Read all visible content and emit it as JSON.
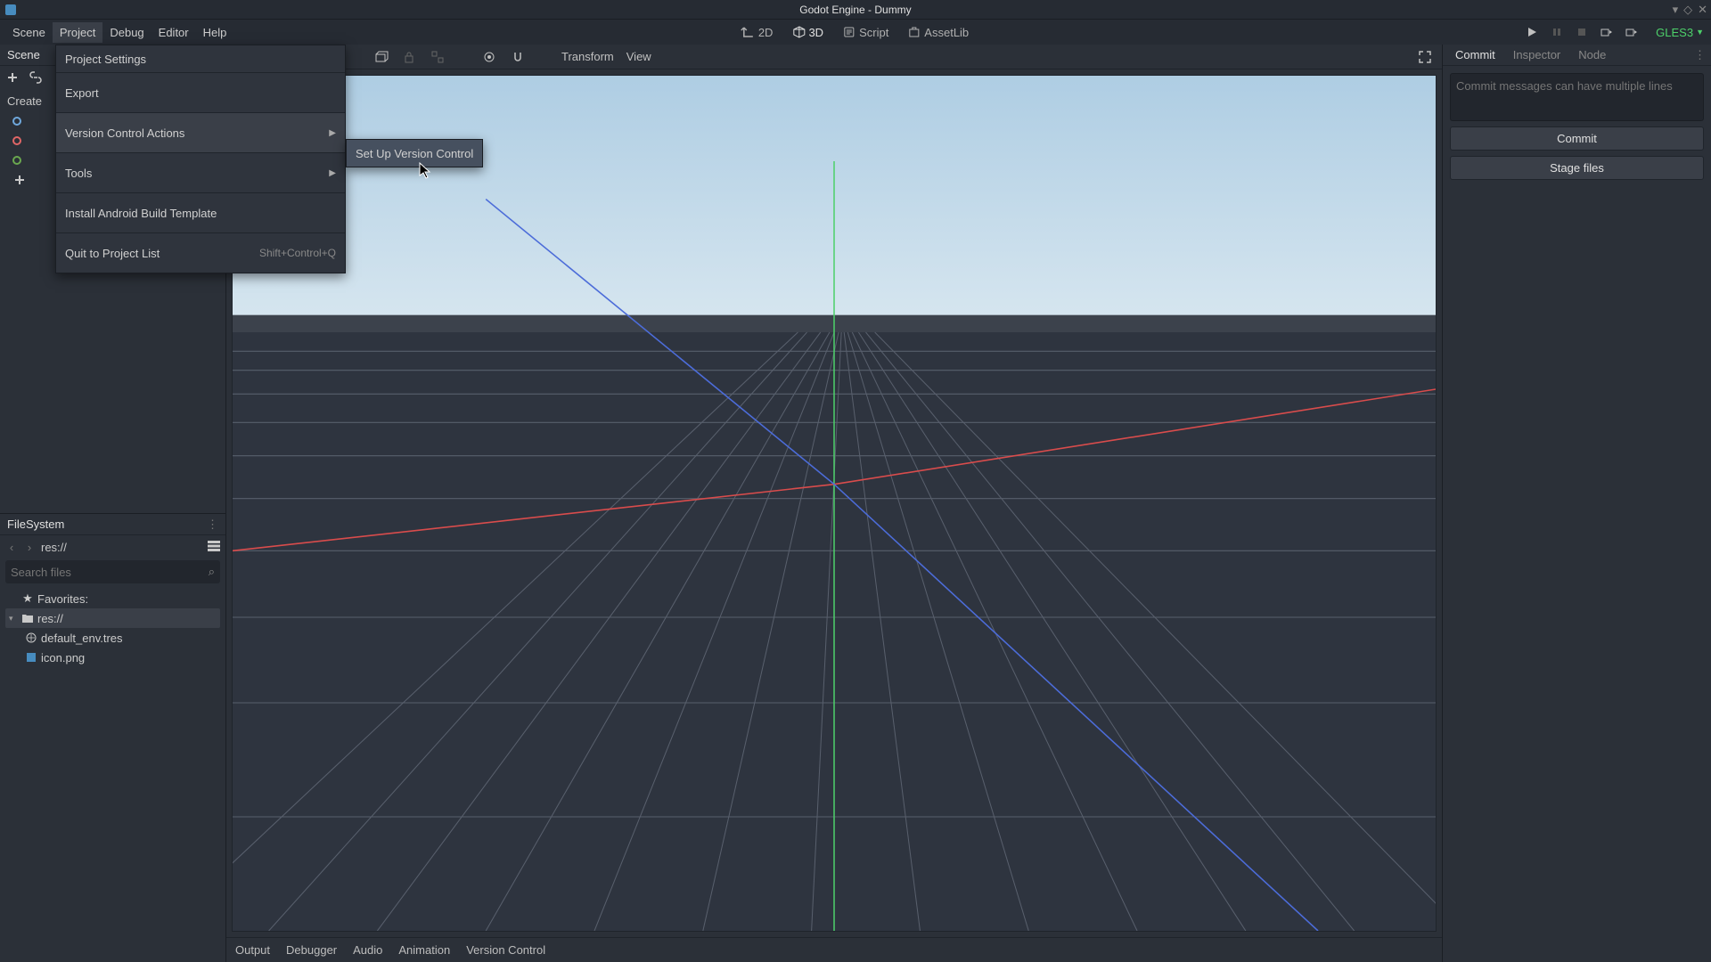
{
  "titlebar": {
    "title": "Godot Engine - Dummy"
  },
  "menubar": {
    "items": [
      "Scene",
      "Project",
      "Debug",
      "Editor",
      "Help"
    ],
    "active_index": 1,
    "modes": {
      "d2": "2D",
      "d3": "3D",
      "script": "Script",
      "assetlib": "AssetLib"
    },
    "renderer": "GLES3"
  },
  "dropdown": {
    "project_settings": "Project Settings",
    "export": "Export",
    "vcs_actions": "Version Control Actions",
    "tools": "Tools",
    "install_android": "Install Android Build Template",
    "quit": "Quit to Project List",
    "quit_shortcut": "Shift+Control+Q"
  },
  "submenu": {
    "setup_vcs": "Set Up Version Control"
  },
  "scene_dock": {
    "title": "Scene",
    "create_label": "Create"
  },
  "filesystem": {
    "title": "FileSystem",
    "path": "res://",
    "search_placeholder": "Search files",
    "favorites": "Favorites:",
    "root": "res://",
    "files": [
      "default_env.tres",
      "icon.png"
    ]
  },
  "viewport_toolbar": {
    "transform": "Transform",
    "view": "View"
  },
  "bottom_tabs": [
    "Output",
    "Debugger",
    "Audio",
    "Animation",
    "Version Control"
  ],
  "right_dock": {
    "tabs": [
      "Commit",
      "Inspector",
      "Node"
    ],
    "active_index": 0,
    "commit_placeholder": "Commit messages can have multiple lines",
    "commit_btn": "Commit",
    "stage_btn": "Stage files"
  }
}
